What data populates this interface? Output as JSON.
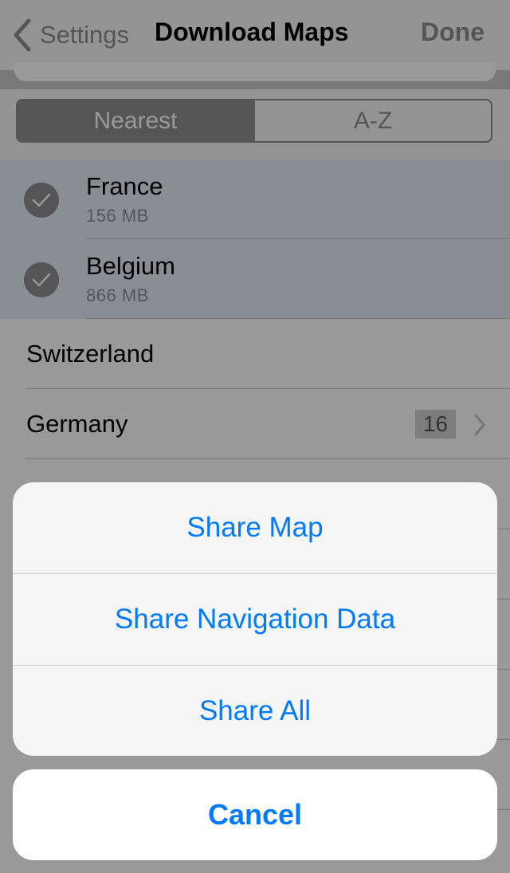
{
  "nav": {
    "back_label": "Settings",
    "title": "Download Maps",
    "done_label": "Done"
  },
  "segments": {
    "items": [
      "Nearest",
      "A-Z"
    ],
    "selected": "Nearest"
  },
  "countries": [
    {
      "name": "France",
      "size": "156 MB",
      "selected": true
    },
    {
      "name": "Belgium",
      "size": "866 MB",
      "selected": true
    },
    {
      "name": "Switzerland",
      "size": "",
      "selected": false
    },
    {
      "name": "Germany",
      "size": "",
      "selected": false,
      "badge": "16",
      "has_chevron": true
    }
  ],
  "action_sheet": {
    "actions": [
      "Share Map",
      "Share Navigation Data",
      "Share All"
    ],
    "cancel_label": "Cancel"
  },
  "colors": {
    "accent": "#007aff",
    "selected_row": "#e4ebf7",
    "segment": "#8e8e93"
  }
}
